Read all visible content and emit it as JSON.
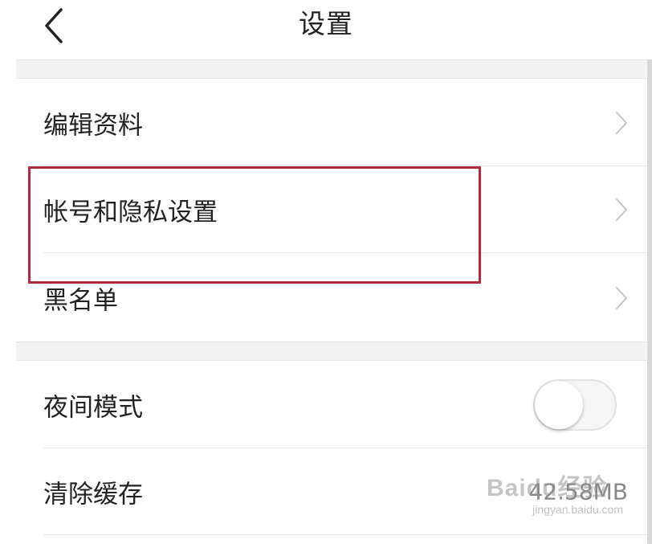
{
  "header": {
    "title": "设置",
    "back_icon": "chevron-left-icon"
  },
  "rows": [
    {
      "label": "编辑资料",
      "trailing": "chevron-right-icon"
    },
    {
      "label": "帐号和隐私设置",
      "trailing": "chevron-right-icon"
    },
    {
      "label": "黑名单",
      "trailing": "chevron-right-icon"
    },
    {
      "label": "夜间模式",
      "trailing": "toggle",
      "toggle_on": false
    },
    {
      "label": "清除缓存",
      "value": "42.58MB"
    }
  ],
  "highlight": {
    "color": "#b0283a",
    "target": "帐号和隐私设置"
  },
  "watermark": {
    "main": "Baidu经验",
    "sub": "jingyan.baidu.com"
  },
  "colors": {
    "background": "#ffffff",
    "separator": "#f3f3f3",
    "text": "#222222",
    "chevron": "#c4c4c4"
  }
}
